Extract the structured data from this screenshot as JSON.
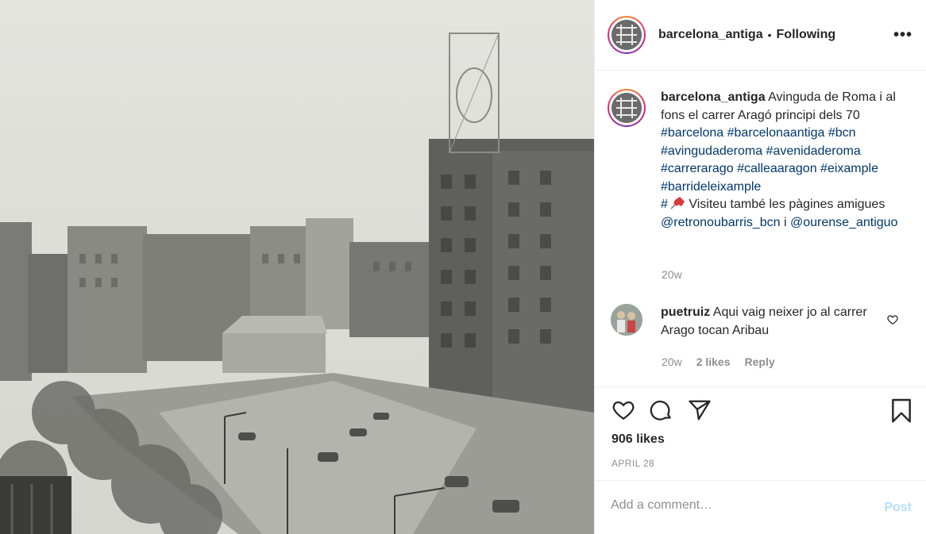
{
  "post": {
    "account": "barcelona_antiga",
    "follow_status": "Following",
    "more_label": "•••",
    "caption": {
      "username": "barcelona_antiga",
      "text_line1": " Avinguda de Roma i al fons el carrer Aragó principi dels 70",
      "hashtags": [
        "#barcelona",
        "#barcelonaantiga",
        "#bcn",
        "#avingudaderoma",
        "#avenidaderoma",
        "#carrerarago",
        "#calleaaragon",
        "#eixample",
        "#barrideleixample"
      ],
      "tail_hash": "#",
      "tail_text": " Visiteu també les pàgines amigues ",
      "mention1": "@retronoubarris_bcn",
      "conj": " i ",
      "mention2": "@ourense_antiguo",
      "time": "20w"
    },
    "comment": {
      "username": "puetruiz",
      "text": " Aqui vaig neixer jo al carrer Arago tocan Aribau",
      "time": "20w",
      "likes": "2 likes",
      "reply": "Reply"
    },
    "likes": "906 likes",
    "date": "APRIL 28",
    "add_comment_placeholder": "Add a comment…",
    "post_button": "Post"
  },
  "colors": {
    "link": "#00376b",
    "muted": "#8e8e8e",
    "post_disabled": "#b2dffc"
  }
}
